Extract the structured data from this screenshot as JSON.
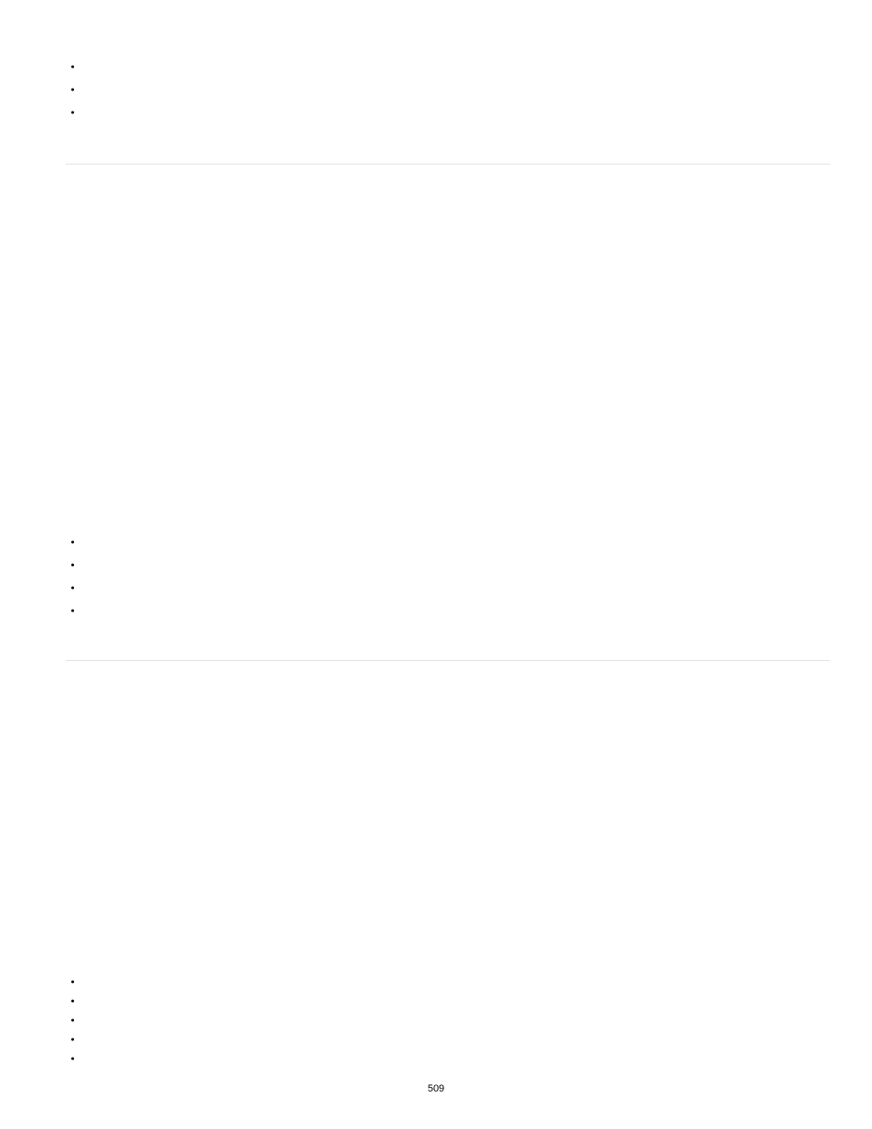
{
  "lists": {
    "list1": [
      "",
      "",
      ""
    ],
    "list2": [
      "",
      "",
      "",
      ""
    ],
    "list3": [
      "",
      "",
      "",
      "",
      ""
    ]
  },
  "page_number": "509"
}
